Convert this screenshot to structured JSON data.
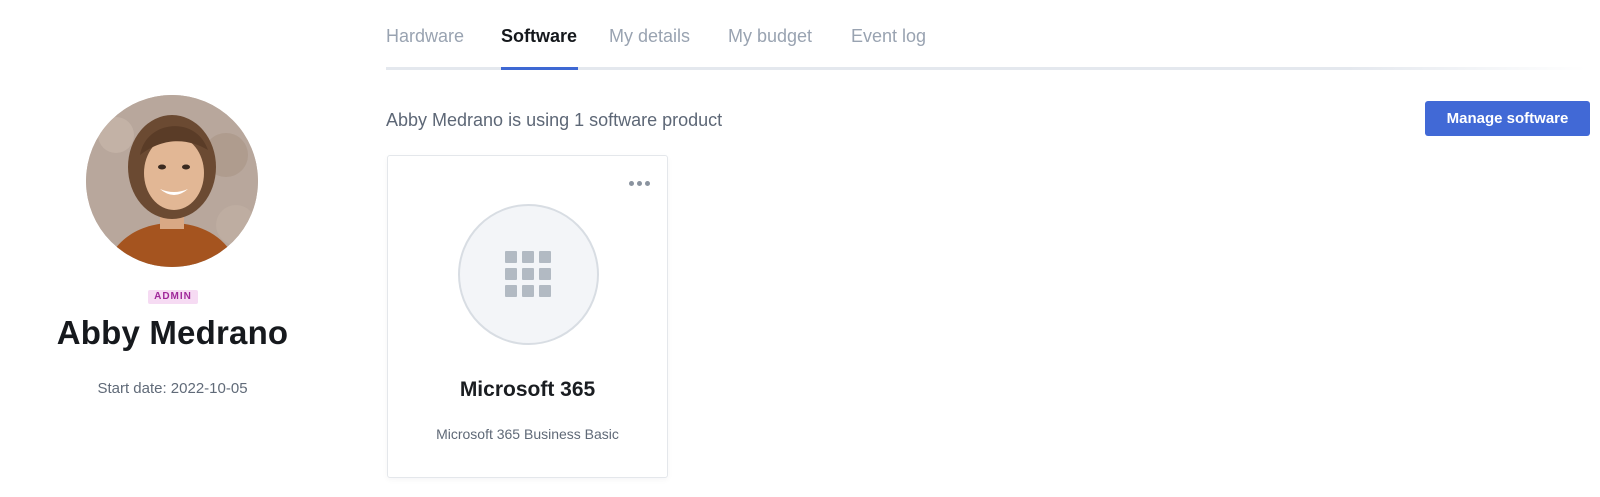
{
  "profile": {
    "role_badge": "ADMIN",
    "name": "Abby Medrano",
    "start_date": "Start date: 2022-10-05"
  },
  "tabs": [
    {
      "label": "Hardware",
      "active": false
    },
    {
      "label": "Software",
      "active": true
    },
    {
      "label": "My details",
      "active": false
    },
    {
      "label": "My budget",
      "active": false
    },
    {
      "label": "Event log",
      "active": false
    }
  ],
  "software": {
    "summary": "Abby Medrano is using 1 software product",
    "manage_button": "Manage software",
    "products": [
      {
        "title": "Microsoft 365",
        "subtitle": "Microsoft 365 Business Basic",
        "icon": "app-grid-icon"
      }
    ]
  },
  "colors": {
    "accent": "#4169d6",
    "badge_bg": "#f6dbf3",
    "badge_text": "#a0289a",
    "tab_inactive": "#99a3b1"
  }
}
